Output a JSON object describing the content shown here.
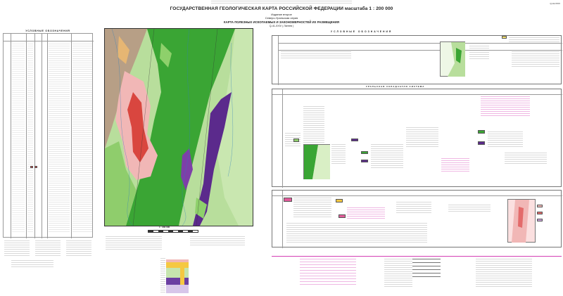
{
  "sheet": {
    "top_right_tag": "Q-41-XXIV",
    "main_title": "ГОСУДАРСТВЕННАЯ ГЕОЛОГИЧЕСКАЯ КАРТА РОССИЙСКОЙ ФЕДЕРАЦИИ масштаба 1 : 200 000",
    "edition": "Издание второе",
    "series": "Северо-Уральская серия",
    "map_title": "КАРТА ПОЛЕЗНЫХ ИСКОПАЕМЫХ И ЗАКОНОМЕРНОСТЕЙ ИХ РАЗМЕЩЕНИЯ",
    "sheet_label": "Q-41-XXIV ( Лаптев )"
  },
  "legend_left": {
    "title": "УСЛОВНЫЕ ОБОЗНАЧЕНИЯ"
  },
  "scale_bar": {
    "label": "1 : 200 000"
  },
  "right_panel": {
    "title": "УСЛОВНЫЕ ОБОЗНАЧЕНИЯ",
    "block_heading": "УРАЛЬСКАЯ СКЛАДЧАТАЯ СИСТЕМА"
  },
  "colors": {
    "map_green": "#3aa534",
    "map_light_green": "#b8de9c",
    "map_pink": "#f1b7b6",
    "map_red": "#d9463f",
    "map_purple": "#5b2a8c",
    "magenta_text": "#d43fb4"
  }
}
